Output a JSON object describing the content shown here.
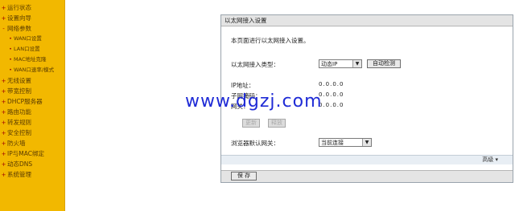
{
  "sidebar": {
    "items": [
      {
        "label": "运行状态",
        "sub": false
      },
      {
        "label": "设置向导",
        "sub": false
      },
      {
        "label": "网络参数",
        "sub": false,
        "mark": "-"
      },
      {
        "label": "WAN口设置",
        "sub": true
      },
      {
        "label": "LAN口设置",
        "sub": true
      },
      {
        "label": "MAC地址克隆",
        "sub": true
      },
      {
        "label": "WAN口速率/模式",
        "sub": true
      },
      {
        "label": "无线设置",
        "sub": false
      },
      {
        "label": "带宽控制",
        "sub": false
      },
      {
        "label": "DHCP服务器",
        "sub": false
      },
      {
        "label": "路由功能",
        "sub": false
      },
      {
        "label": "转发规则",
        "sub": false
      },
      {
        "label": "安全控制",
        "sub": false
      },
      {
        "label": "防火墙",
        "sub": false
      },
      {
        "label": "IP与MAC绑定",
        "sub": false
      },
      {
        "label": "动态DNS",
        "sub": false
      },
      {
        "label": "系统管理",
        "sub": false
      }
    ]
  },
  "panel": {
    "title": "以太网接入设置",
    "intro": "本页面进行以太网接入设置。",
    "access_type_label": "以太网接入类型：",
    "access_type_value": "动态IP",
    "auto_detect_button": "自动检测",
    "ip_label": "IP地址：",
    "ip_value": "0.0.0.0",
    "mask_label": "子网掩码：",
    "mask_value": "0.0.0.0",
    "gateway_label": "网关：",
    "gateway_value": "0.0.0.0",
    "update_button": "更新",
    "release_button": "释放",
    "gateway_select_label": "浏览器默认网关：",
    "gateway_select_value": "当前连接",
    "advanced_link": "高级",
    "save_button": "保 存"
  },
  "watermark": "www.dgzj.com",
  "colors": {
    "sidebar_bg": "#f2b800",
    "watermark": "#1f2bd6"
  }
}
